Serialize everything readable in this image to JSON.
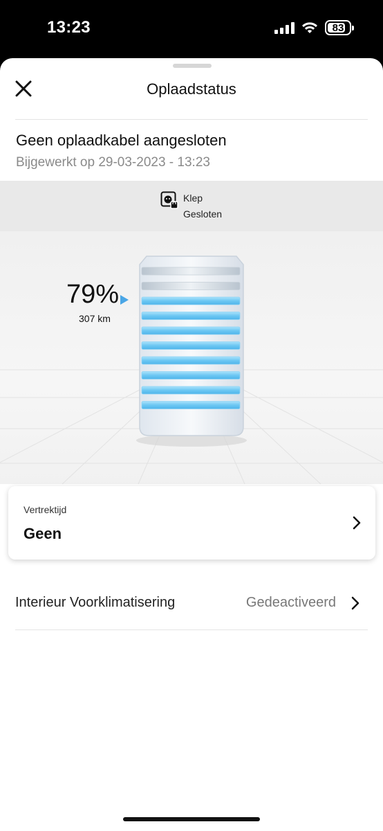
{
  "status_bar": {
    "time": "13:23",
    "battery": "83",
    "battery_level": 0.83
  },
  "header": {
    "title": "Oplaadstatus"
  },
  "connection": {
    "title": "Geen oplaadkabel aangesloten",
    "updated": "Bijgewerkt op 29-03-2023 - 13:23"
  },
  "flap": {
    "label": "Klep",
    "state": "Gesloten"
  },
  "battery": {
    "percent_label": "79%",
    "range_label": "307 km",
    "level_percent": 79,
    "segments_total": 10,
    "segments_filled": 8
  },
  "departure_card": {
    "label": "Vertrektijd",
    "value": "Geen"
  },
  "preclimate": {
    "label": "Interieur Voorklimatisering",
    "value": "Gedeactiveerd"
  },
  "colors": {
    "accent_blue": "#4aa6e6",
    "segment_blue": "#7ccff7"
  }
}
